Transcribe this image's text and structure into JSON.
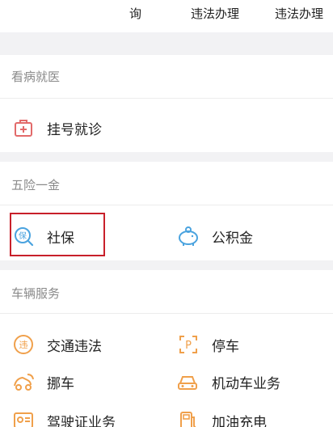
{
  "top_row": {
    "items": [
      {
        "label": "询"
      },
      {
        "label": "违法办理"
      },
      {
        "label": "违法办理"
      }
    ]
  },
  "sections": [
    {
      "title": "看病就医",
      "items": [
        {
          "label": "挂号就诊",
          "icon": "medical-kit-icon"
        }
      ]
    },
    {
      "title": "五险一金",
      "items": [
        {
          "label": "社保",
          "icon": "social-insurance-icon"
        },
        {
          "label": "公积金",
          "icon": "piggy-bank-icon"
        }
      ]
    },
    {
      "title": "车辆服务",
      "items": [
        {
          "label": "交通违法",
          "icon": "traffic-violation-icon"
        },
        {
          "label": "停车",
          "icon": "parking-icon"
        },
        {
          "label": "挪车",
          "icon": "move-car-icon"
        },
        {
          "label": "机动车业务",
          "icon": "car-service-icon"
        },
        {
          "label": "驾驶证业务",
          "icon": "driver-license-icon"
        },
        {
          "label": "加油充电",
          "icon": "fuel-charge-icon"
        }
      ]
    }
  ],
  "colors": {
    "accent_orange": "#f0a04b",
    "accent_blue": "#4aa3df",
    "medical_red": "#e26a6a",
    "highlight_red": "#c8202a"
  }
}
